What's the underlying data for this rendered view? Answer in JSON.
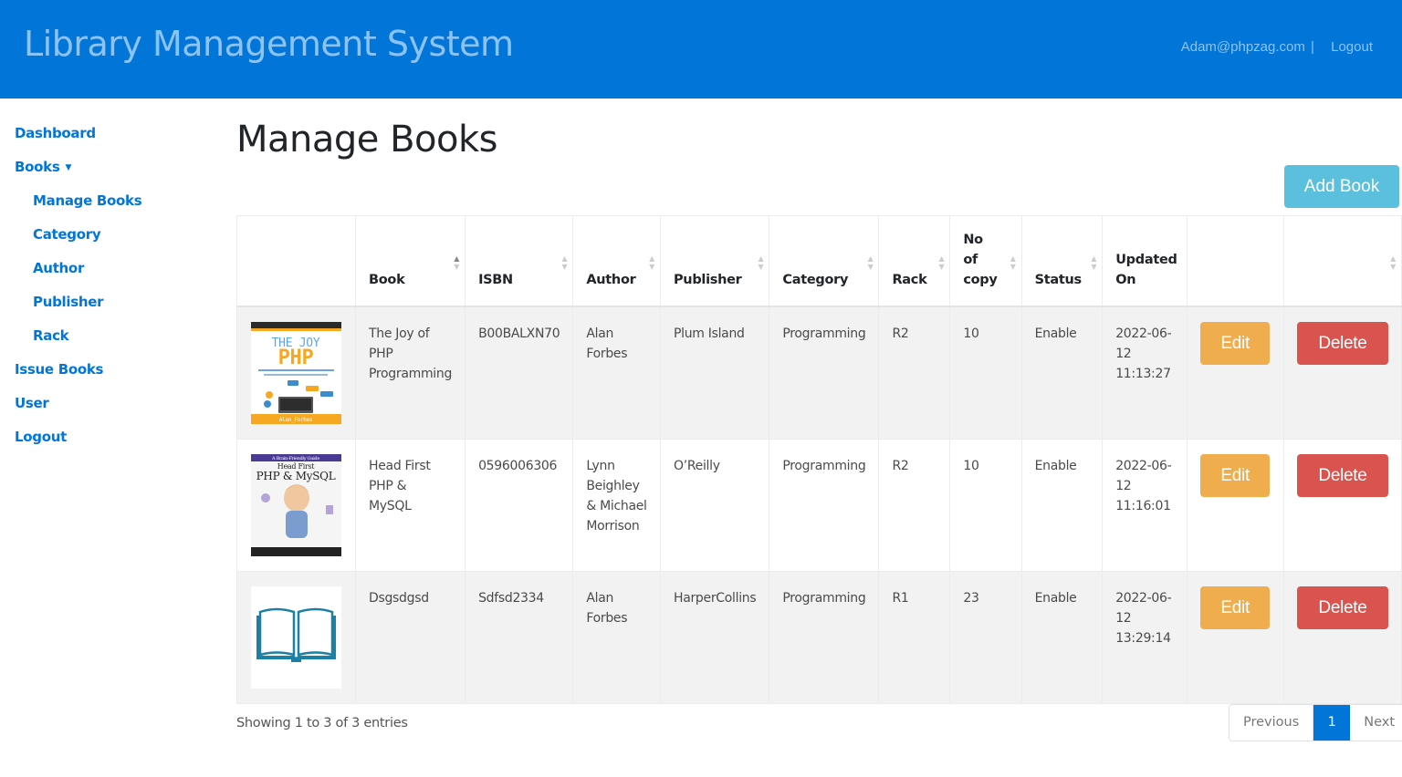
{
  "header": {
    "title": "Library Management System",
    "user_email": "Adam@phpzag.com",
    "separator": "|",
    "logout_label": "Logout"
  },
  "sidebar": {
    "items": [
      {
        "label": "Dashboard",
        "level": 0
      },
      {
        "label": "Books",
        "level": 0,
        "expanded": true,
        "caret": "▼"
      },
      {
        "label": "Manage Books",
        "level": 1
      },
      {
        "label": "Category",
        "level": 1
      },
      {
        "label": "Author",
        "level": 1
      },
      {
        "label": "Publisher",
        "level": 1
      },
      {
        "label": "Rack",
        "level": 1
      },
      {
        "label": "Issue Books",
        "level": 0
      },
      {
        "label": "User",
        "level": 0
      },
      {
        "label": "Logout",
        "level": 0
      }
    ]
  },
  "main": {
    "title": "Manage Books",
    "add_button_label": "Add Book",
    "table": {
      "columns": [
        {
          "label": "",
          "sortable": false
        },
        {
          "label": "Book",
          "sortable": true,
          "sorted": "asc"
        },
        {
          "label": "ISBN",
          "sortable": true
        },
        {
          "label": "Author",
          "sortable": true
        },
        {
          "label": "Publisher",
          "sortable": true
        },
        {
          "label": "Category",
          "sortable": true
        },
        {
          "label": "Rack",
          "sortable": true
        },
        {
          "label": "No of copy",
          "sortable": true
        },
        {
          "label": "Status",
          "sortable": true
        },
        {
          "label": "Updated On",
          "sortable": false
        },
        {
          "label": "",
          "sortable": false
        },
        {
          "label": "",
          "sortable": true
        }
      ],
      "rows": [
        {
          "cover": "the-joy-of-php-cover",
          "book": "The Joy of PHP Programming",
          "isbn": "B00BALXN70",
          "author": "Alan Forbes",
          "publisher": "Plum Island",
          "category": "Programming",
          "rack": "R2",
          "copies": "10",
          "status": "Enable",
          "updated": "2022-06-12 11:13:27",
          "edit_label": "Edit",
          "delete_label": "Delete"
        },
        {
          "cover": "head-first-php-mysql-cover",
          "book": "Head First PHP & MySQL",
          "isbn": "0596006306",
          "author": "Lynn Beighley & Michael Morrison",
          "publisher": "O’Reilly",
          "category": "Programming",
          "rack": "R2",
          "copies": "10",
          "status": "Enable",
          "updated": "2022-06-12 11:16:01",
          "edit_label": "Edit",
          "delete_label": "Delete"
        },
        {
          "cover": "open-book-placeholder",
          "book": "Dsgsdgsd",
          "isbn": "Sdfsd2334",
          "author": "Alan Forbes",
          "publisher": "HarperCollins",
          "category": "Programming",
          "rack": "R1",
          "copies": "23",
          "status": "Enable",
          "updated": "2022-06-12 13:29:14",
          "edit_label": "Edit",
          "delete_label": "Delete"
        }
      ]
    },
    "info_text": "Showing 1 to 3 of 3 entries",
    "pagination": {
      "previous_label": "Previous",
      "current_page": "1",
      "next_label": "Next"
    }
  },
  "colors": {
    "header_bg": "#0275d8",
    "link": "#0275d8",
    "add_button": "#5bc0de",
    "edit_button": "#f0ad4e",
    "delete_button": "#d9534f"
  }
}
